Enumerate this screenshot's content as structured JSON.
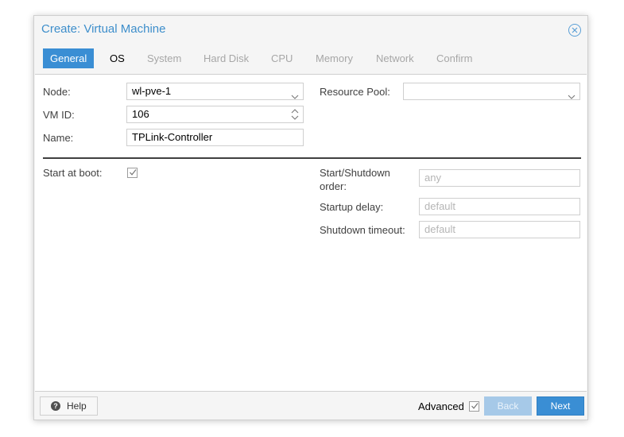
{
  "window": {
    "title": "Create: Virtual Machine"
  },
  "tabs": [
    {
      "label": "General",
      "state": "active"
    },
    {
      "label": "OS",
      "state": "enabled"
    },
    {
      "label": "System",
      "state": "disabled"
    },
    {
      "label": "Hard Disk",
      "state": "disabled"
    },
    {
      "label": "CPU",
      "state": "disabled"
    },
    {
      "label": "Memory",
      "state": "disabled"
    },
    {
      "label": "Network",
      "state": "disabled"
    },
    {
      "label": "Confirm",
      "state": "disabled"
    }
  ],
  "form": {
    "node": {
      "label": "Node:",
      "value": "wl-pve-1"
    },
    "vmid": {
      "label": "VM ID:",
      "value": "106"
    },
    "name": {
      "label": "Name:",
      "value": "TPLink-Controller"
    },
    "resource_pool": {
      "label": "Resource Pool:",
      "value": ""
    },
    "start_at_boot": {
      "label": "Start at boot:",
      "checked": true
    },
    "startup_order": {
      "label_line1": "Start/Shutdown",
      "label_line2": "order:",
      "placeholder": "any"
    },
    "startup_delay": {
      "label": "Startup delay:",
      "placeholder": "default"
    },
    "shutdown_timeout": {
      "label": "Shutdown timeout:",
      "placeholder": "default"
    }
  },
  "footer": {
    "help_label": "Help",
    "advanced_label": "Advanced",
    "advanced_checked": true,
    "back_label": "Back",
    "next_label": "Next"
  },
  "colors": {
    "accent": "#3a8ed4",
    "title": "#3d8ecb",
    "disabled_text": "#a7a7a7"
  },
  "icons": {
    "close": "close-circle-icon",
    "help": "question-circle-icon",
    "dropdown": "chevron-down-icon",
    "spinner": "up-down-spinner-icon",
    "check": "checkmark-icon"
  }
}
